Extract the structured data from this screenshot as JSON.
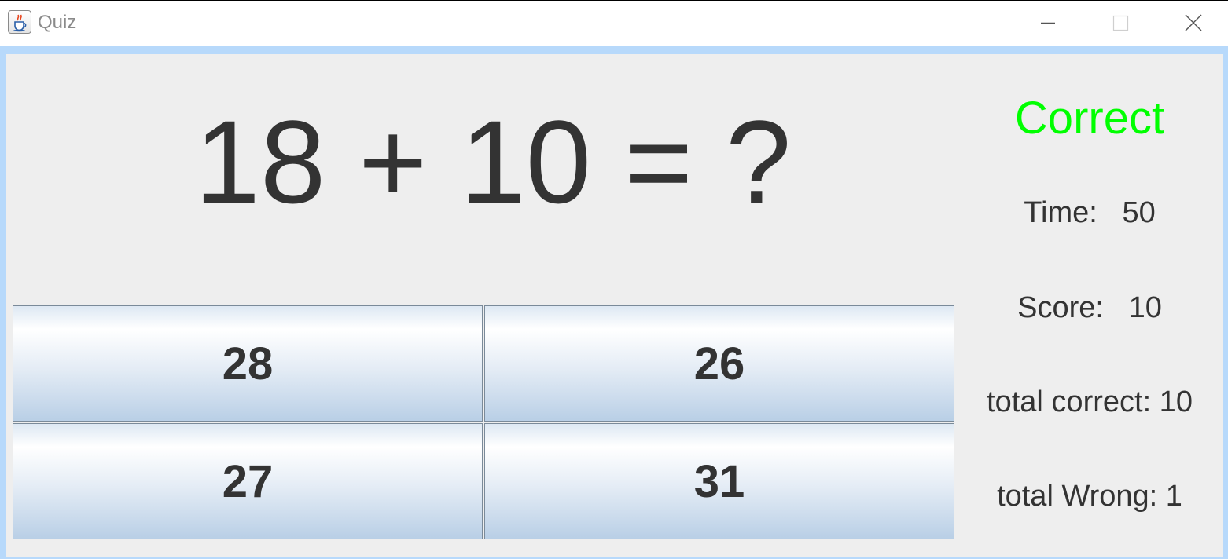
{
  "window": {
    "title": "Quiz",
    "icon": "java-cup-icon"
  },
  "question": {
    "text": "18 + 10 = ?"
  },
  "status": {
    "text": "Correct",
    "color": "#00ff00"
  },
  "stats": {
    "time": "Time:   50",
    "score": "Score:   10",
    "total_correct": "total correct: 10",
    "total_wrong": "total Wrong: 1"
  },
  "answers": [
    "28",
    "26",
    "27",
    "31"
  ]
}
